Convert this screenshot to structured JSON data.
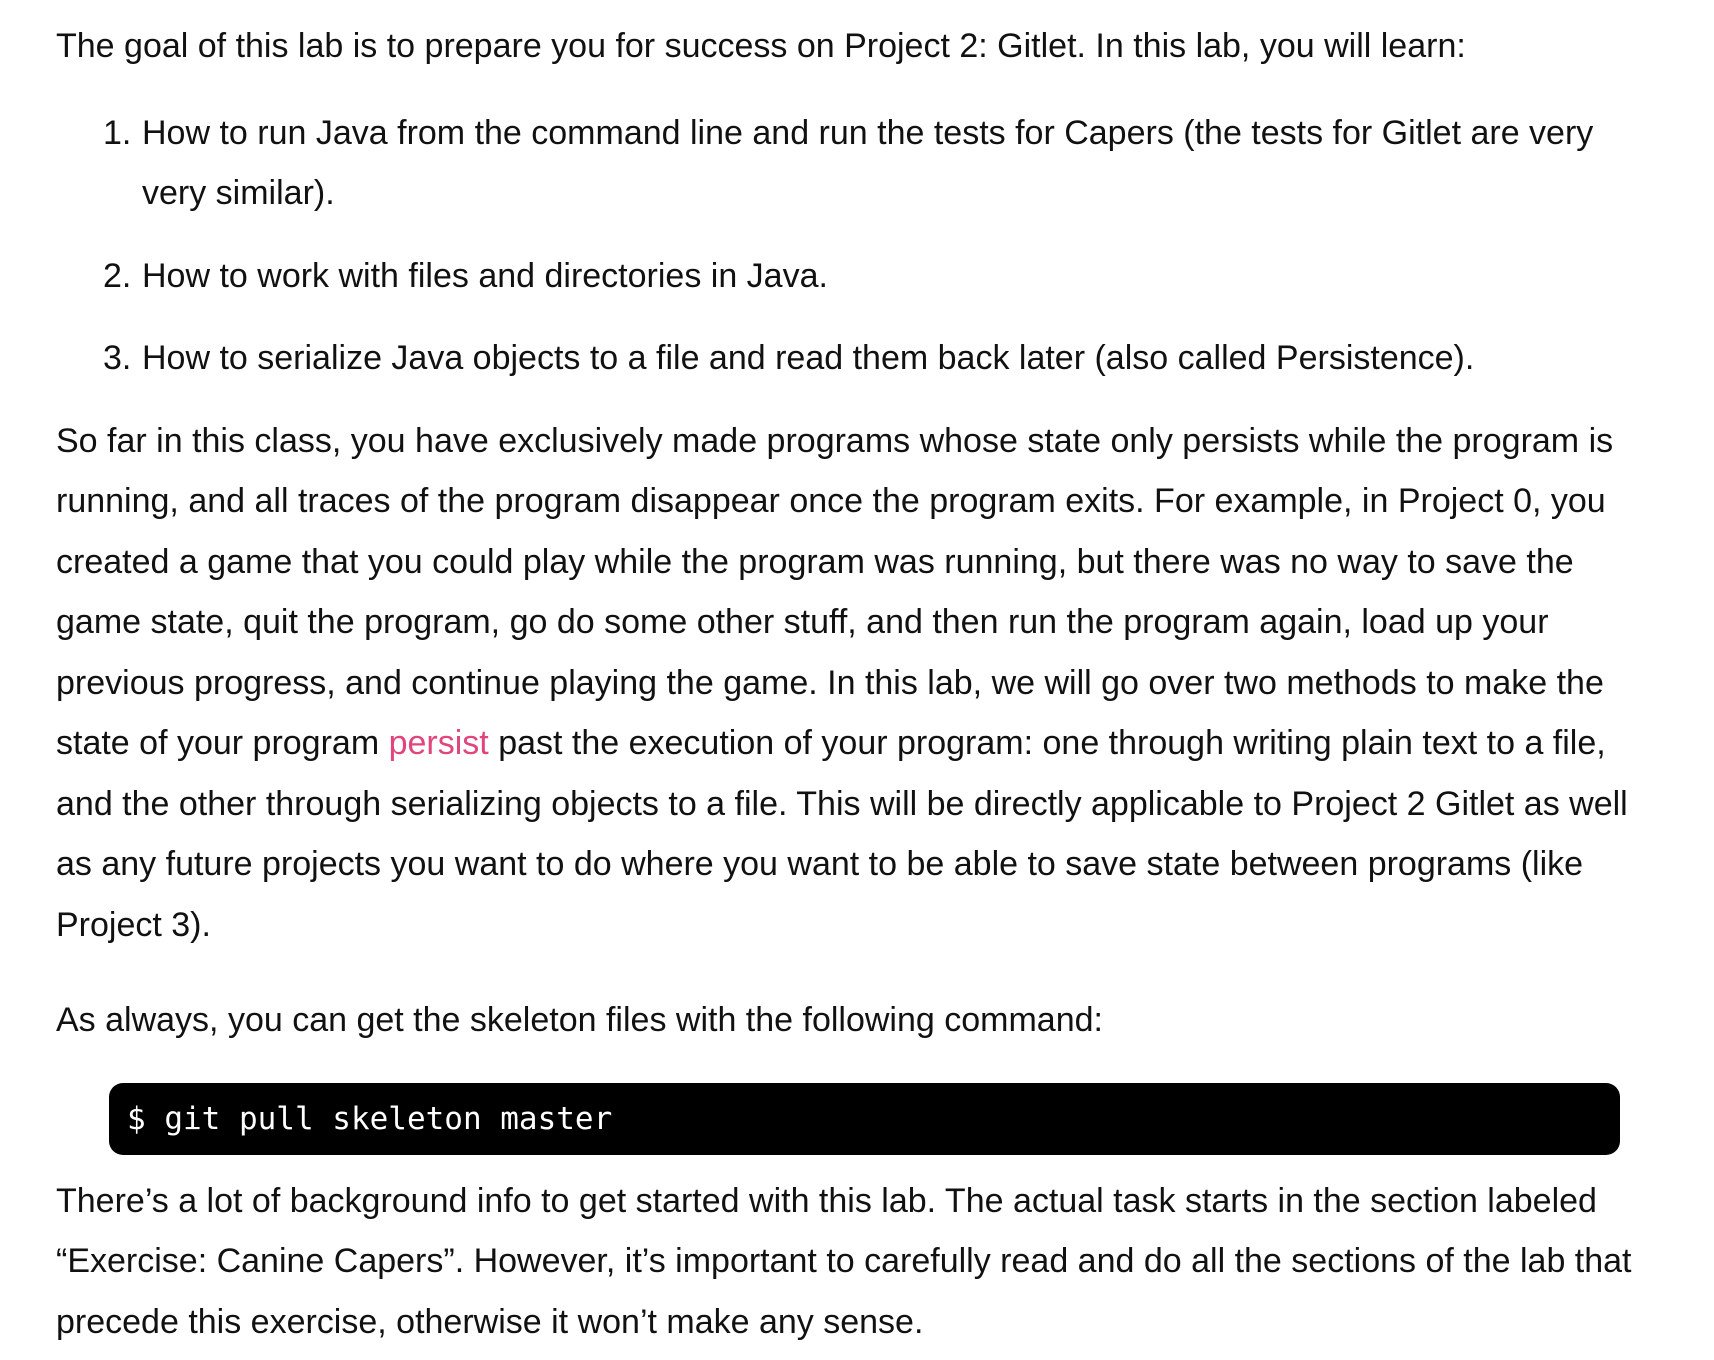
{
  "intro": "The goal of this lab is to prepare you for success on Project 2: Gitlet. In this lab, you will learn:",
  "goals": [
    {
      "number": "1.",
      "text": "How to run Java from the command line and run the tests for Capers (the tests for Gitlet are very very similar)."
    },
    {
      "number": "2.",
      "text": "How to work with files and directories in Java."
    },
    {
      "number": "3.",
      "text": "How to serialize Java objects to a file and read them back later (also called Persistence)."
    }
  ],
  "paragraph1": {
    "before_link": "So far in this class, you have exclusively made programs whose state only persists while the program is running, and all traces of the program disappear once the program exits. For example, in Project 0, you created a game that you could play while the program was running, but there was no way to save the game state, quit the program, go do some other stuff, and then run the program again, load up your previous progress, and continue playing the game. In this lab, we will go over two methods to make the state of your program ",
    "link_text": "persist",
    "after_link": " past the execution of your program: one through writing plain text to a file, and the other through serializing objects to a file. This will be directly applicable to Project 2 Gitlet as well as any future projects you want to do where you want to be able to save state between programs (like Project 3)."
  },
  "paragraph2": "As always, you can get the skeleton files with the following command:",
  "command": "$ git pull skeleton master",
  "paragraph3": "There’s a lot of background info to get started with this lab. The actual task starts in the section labeled “Exercise: Canine Capers”. However, it’s important to carefully read and do all the sections of the lab that precede this exercise, otherwise it won’t make any sense.",
  "colors": {
    "text": "#111111",
    "link": "#e0457b",
    "code_background": "#000000",
    "code_text": "#ffffff"
  }
}
